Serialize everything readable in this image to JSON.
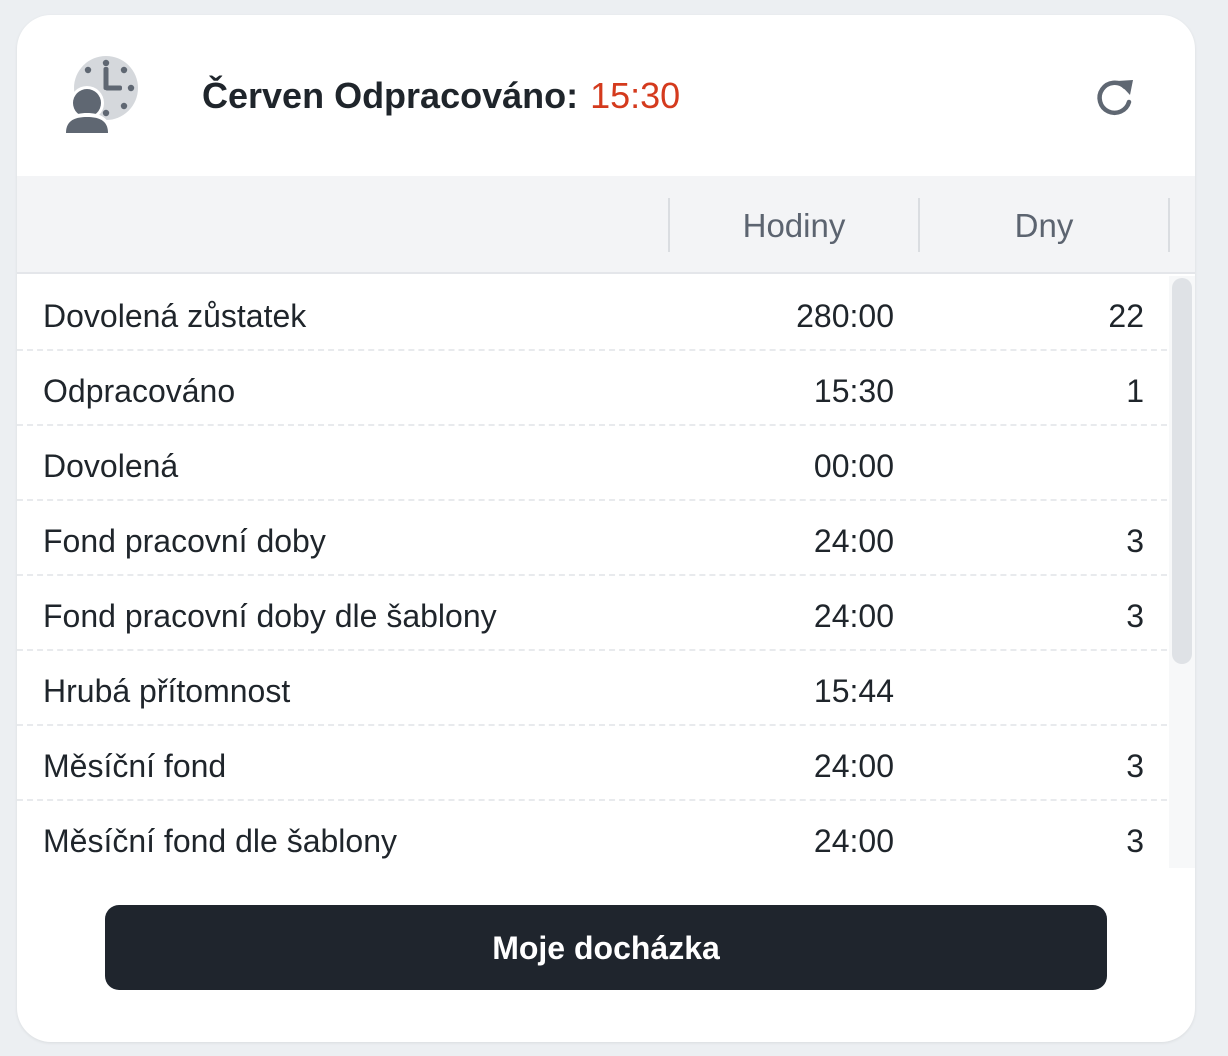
{
  "header": {
    "icon": "clock-person-icon",
    "title": "Červen Odpracováno:",
    "value": "15:30",
    "value_color": "#d43a1d",
    "refresh_icon": "refresh-icon"
  },
  "table": {
    "columns": [
      "",
      "Hodiny",
      "Dny"
    ],
    "rows": [
      {
        "label": "Dovolená zůstatek",
        "hours": "280:00",
        "days": "22"
      },
      {
        "label": "Odpracováno",
        "hours": "15:30",
        "days": "1"
      },
      {
        "label": "Dovolená",
        "hours": "00:00",
        "days": ""
      },
      {
        "label": "Fond pracovní doby",
        "hours": "24:00",
        "days": "3"
      },
      {
        "label": "Fond pracovní doby dle šablony",
        "hours": "24:00",
        "days": "3"
      },
      {
        "label": "Hrubá přítomnost",
        "hours": "15:44",
        "days": ""
      },
      {
        "label": "Měsíční fond",
        "hours": "24:00",
        "days": "3"
      },
      {
        "label": "Měsíční fond dle šablony",
        "hours": "24:00",
        "days": "3"
      }
    ]
  },
  "footer": {
    "button_label": "Moje docházka"
  }
}
